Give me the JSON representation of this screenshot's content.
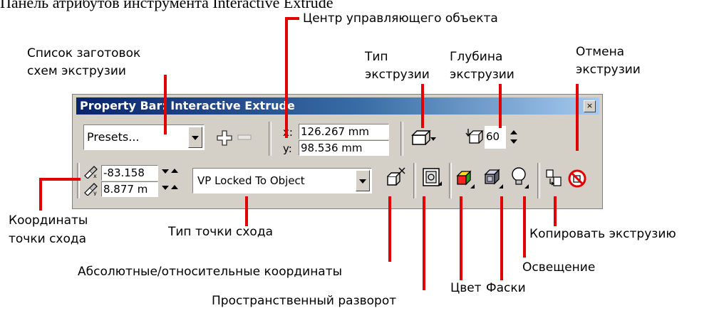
{
  "heading": "Панель атрибутов инструмента Interactive Extrude",
  "toolbar": {
    "title": "Property Bar: Interactive Extrude",
    "close_symbol": "×",
    "presets_value": "Presets...",
    "x_label": "x:",
    "x_value": "126.267 mm",
    "y_label": "y:",
    "y_value": "98.536 mm",
    "depth_value": "60",
    "vp_x_value": "-83.158",
    "vp_y_value": "8.877 m",
    "vp_type_value": "VP Locked To Object"
  },
  "callouts": {
    "presets_list": [
      "Список заготовок",
      "схем экструзии"
    ],
    "control_center": "Центр управляющего объекта",
    "extrusion_type": [
      "Тип",
      "экструзии"
    ],
    "extrusion_depth": [
      "Глубина",
      "экструзии"
    ],
    "clear_extrusion": [
      "Отмена",
      "экструзии"
    ],
    "vp_coordinates": [
      "Координаты",
      "точки схода"
    ],
    "vp_type": "Тип точки схода",
    "copy_extrusion": "Копировать экструзию",
    "lighting": "Освещение",
    "abs_rel_coords": "Абсолютные/относительные координаты",
    "color": "Цвет",
    "bevels": "Фаски",
    "rotation": "Пространственный разворот"
  },
  "colors": {
    "leader": "#e00000",
    "titlebar": "#0a246a",
    "panel": "#d4d0c8"
  },
  "icons": [
    "plus-icon",
    "minus-icon",
    "extrusion-type-icon",
    "depth-icon",
    "vp-x-icon",
    "vp-y-icon",
    "abs-rel-coords-icon",
    "rotation-icon",
    "color-icon",
    "bevel-icon",
    "lighting-icon",
    "copy-extrusion-icon",
    "clear-extrusion-icon"
  ]
}
